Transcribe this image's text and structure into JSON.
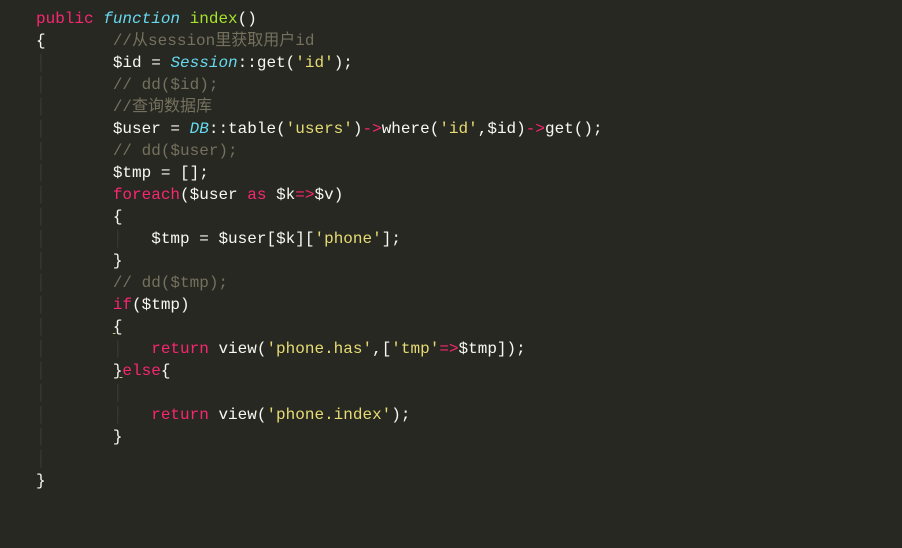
{
  "tokens": {
    "t_public": "public",
    "t_function": "function",
    "t_index": "index",
    "t_paren_oc": "()",
    "t_obrace": "{",
    "t_cbrace": "}",
    "t_comment_session": "//从session里获取用户id",
    "t_id_var": "$id",
    "t_eq": " = ",
    "t_session": "Session",
    "t_colcol": "::",
    "t_get": "get",
    "t_oparen": "(",
    "t_str_id": "'id'",
    "t_cparen": ")",
    "t_semi": ";",
    "t_comment_ddid": "// dd($id);",
    "t_comment_query": "//查询数据库",
    "t_user_var": "$user",
    "t_db": "DB",
    "t_table": "table",
    "t_str_users": "'users'",
    "t_arrow": "->",
    "t_where": "where",
    "t_comma": ",",
    "t_comment_dduser": "// dd($user);",
    "t_tmp_var": "$tmp",
    "t_emptyarr": "[]",
    "t_foreach": "foreach",
    "t_as": "as",
    "t_k_var": "$k",
    "t_fatarrow": "=>",
    "t_v_var": "$v",
    "t_obracket": "[",
    "t_cbracket": "]",
    "t_str_phone": "'phone'",
    "t_comment_ddtmp": "// dd($tmp);",
    "t_if": "if",
    "t_return": "return",
    "t_view": "view",
    "t_str_phonehas": "'phone.has'",
    "t_str_tmp": "'tmp'",
    "t_else": "else",
    "t_str_phoneindex": "'phone.index'"
  }
}
